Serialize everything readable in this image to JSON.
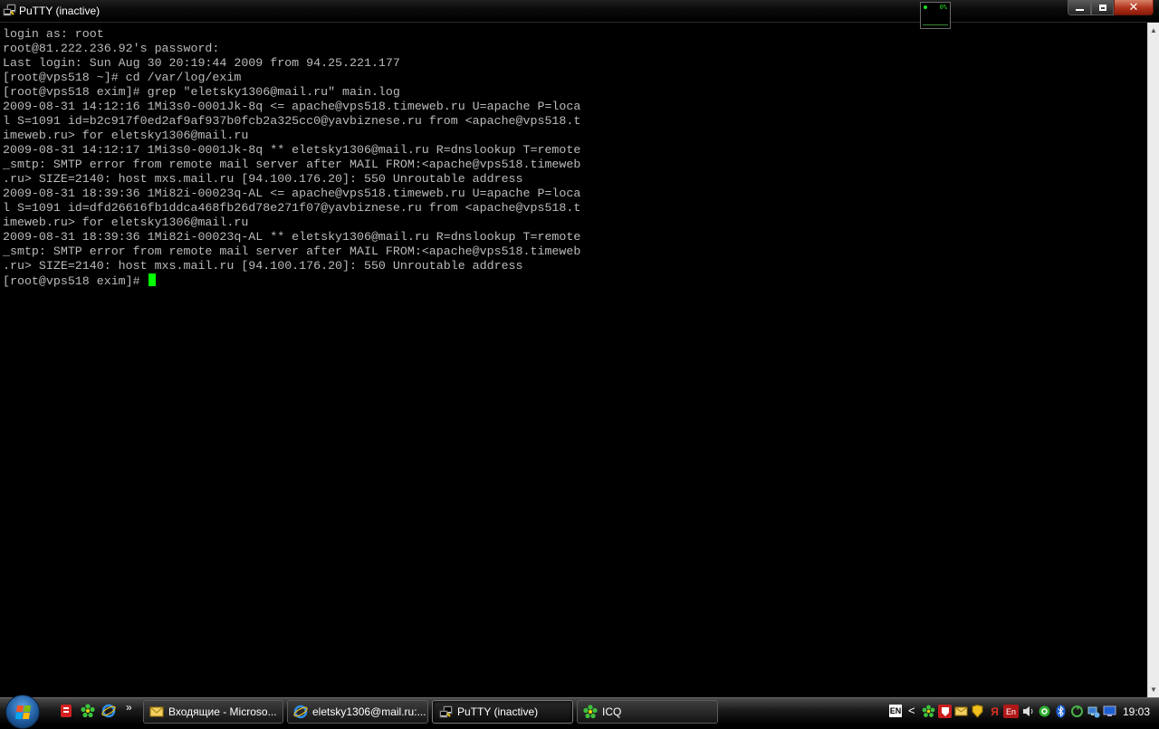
{
  "window": {
    "title": "PuTTY (inactive)",
    "icon": "putty-icon"
  },
  "cpu_meter": {
    "label": "0%"
  },
  "terminal": {
    "lines": [
      "login as: root",
      "root@81.222.236.92's password:",
      "Last login: Sun Aug 30 20:19:44 2009 from 94.25.221.177",
      "[root@vps518 ~]# cd /var/log/exim",
      "[root@vps518 exim]# grep \"eletsky1306@mail.ru\" main.log",
      "2009-08-31 14:12:16 1Mi3s0-0001Jk-8q <= apache@vps518.timeweb.ru U=apache P=loca",
      "l S=1091 id=b2c917f0ed2af9af937b0fcb2a325cc0@yavbiznese.ru from <apache@vps518.t",
      "imeweb.ru> for eletsky1306@mail.ru",
      "2009-08-31 14:12:17 1Mi3s0-0001Jk-8q ** eletsky1306@mail.ru R=dnslookup T=remote",
      "_smtp: SMTP error from remote mail server after MAIL FROM:<apache@vps518.timeweb",
      ".ru> SIZE=2140: host mxs.mail.ru [94.100.176.20]: 550 Unroutable address",
      "2009-08-31 18:39:36 1Mi82i-00023q-AL <= apache@vps518.timeweb.ru U=apache P=loca",
      "l S=1091 id=dfd26616fb1ddca468fb26d78e271f07@yavbiznese.ru from <apache@vps518.t",
      "imeweb.ru> for eletsky1306@mail.ru",
      "2009-08-31 18:39:36 1Mi82i-00023q-AL ** eletsky1306@mail.ru R=dnslookup T=remote",
      "_smtp: SMTP error from remote mail server after MAIL FROM:<apache@vps518.timeweb",
      ".ru> SIZE=2140: host mxs.mail.ru [94.100.176.20]: 550 Unroutable address"
    ],
    "prompt": "[root@vps518 exim]# ",
    "text_color": "#bbbbbb",
    "cursor_color": "#00ff00",
    "background_color": "#000000"
  },
  "taskbar": {
    "quick_launch": [
      {
        "icon": "red-app-icon"
      },
      {
        "icon": "icq-flower-icon"
      },
      {
        "icon": "internet-explorer-icon"
      }
    ],
    "more_label": "»",
    "tasks": [
      {
        "label": "Входящие - Microso...",
        "icon": "outlook-icon",
        "active": false
      },
      {
        "label": "eletsky1306@mail.ru:...",
        "icon": "internet-explorer-icon",
        "active": false
      },
      {
        "label": "PuTTY (inactive)",
        "icon": "putty-icon",
        "active": true
      },
      {
        "label": "ICQ",
        "icon": "icq-flower-icon",
        "active": false
      }
    ],
    "tray": {
      "language": "EN",
      "expand_label": "<",
      "icons": [
        {
          "icon": "icq-flower-icon"
        },
        {
          "icon": "red-shield-icon"
        },
        {
          "icon": "outlook-tray-icon"
        },
        {
          "icon": "security-shield-icon"
        },
        {
          "icon": "yandex-icon"
        },
        {
          "icon": "en-keyboard-icon",
          "label": "En"
        },
        {
          "icon": "volume-icon"
        },
        {
          "icon": "green-at-icon"
        },
        {
          "icon": "bluetooth-icon"
        },
        {
          "icon": "recycle-icon"
        },
        {
          "icon": "network-icon"
        },
        {
          "icon": "monitor-icon"
        }
      ],
      "clock": "19:03"
    }
  }
}
